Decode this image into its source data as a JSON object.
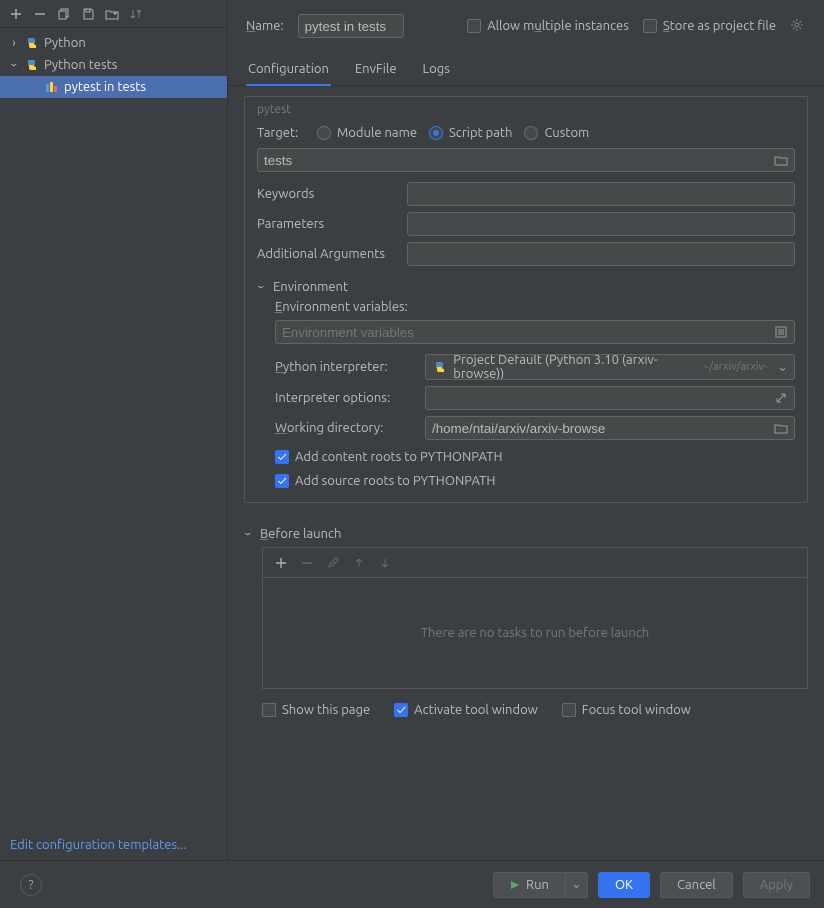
{
  "toolbar": {},
  "tree": {
    "root1": "Python",
    "root2": "Python tests",
    "leaf": "pytest in tests"
  },
  "edit_templates": "Edit configuration templates...",
  "header": {
    "name_label": "Name:",
    "name_value": "pytest in tests",
    "allow_multiple": "Allow multiple instances",
    "store_as_project": "Store as project file"
  },
  "tabs": {
    "configuration": "Configuration",
    "envfile": "EnvFile",
    "logs": "Logs"
  },
  "pytest": {
    "section_label": "pytest",
    "target_label": "Target:",
    "target_module": "Module name",
    "target_script": "Script path",
    "target_custom": "Custom",
    "script_value": "tests",
    "keywords_label": "Keywords",
    "parameters_label": "Parameters",
    "additional_args_label": "Additional Arguments"
  },
  "env": {
    "section_label": "Environment",
    "envvars_label": "Environment variables:",
    "envvars_placeholder": "Environment variables",
    "interp_label": "Python interpreter:",
    "interp_value": "Project Default (Python 3.10 (arxiv-browse))",
    "interp_path": "~/arxiv/arxiv-",
    "interp_opts_label": "Interpreter options:",
    "workdir_label": "Working directory:",
    "workdir_value": "/home/ntai/arxiv/arxiv-browse",
    "add_content_roots": "Add content roots to PYTHONPATH",
    "add_source_roots": "Add source roots to PYTHONPATH"
  },
  "before_launch": {
    "section_label": "Before launch",
    "empty_text": "There are no tasks to run before launch",
    "show_this_page": "Show this page",
    "activate_tool_window": "Activate tool window",
    "focus_tool_window": "Focus tool window"
  },
  "buttons": {
    "run": "Run",
    "ok": "OK",
    "cancel": "Cancel",
    "apply": "Apply"
  }
}
